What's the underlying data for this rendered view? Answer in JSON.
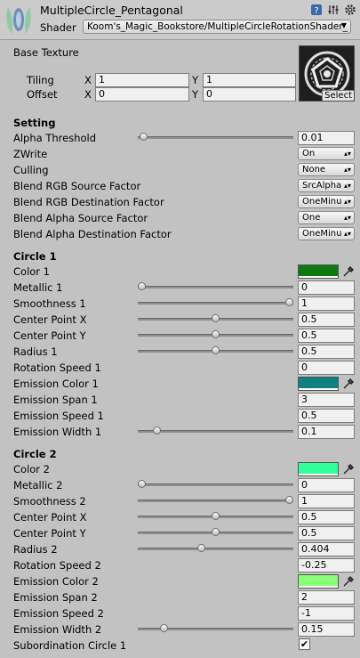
{
  "header": {
    "title": "MultipleCircle_Pentagonal",
    "shader_label": "Shader",
    "shader_value": "Koom's_Magic_Bookstore/MultipleCircleRotationShader_"
  },
  "base_texture": {
    "label": "Base Texture",
    "tiling_label": "Tiling",
    "offset_label": "Offset",
    "x_label": "X",
    "y_label": "Y",
    "tiling_x": "1",
    "tiling_y": "1",
    "offset_x": "0",
    "offset_y": "0",
    "select_label": "Select"
  },
  "setting": {
    "title": "Setting",
    "alpha_threshold": {
      "label": "Alpha Threshold",
      "value": "0.01",
      "level": 0.01
    },
    "zwrite": {
      "label": "ZWrite",
      "value": "On"
    },
    "culling": {
      "label": "Culling",
      "value": "None"
    },
    "blend_rgb_src": {
      "label": "Blend RGB Source Factor",
      "value": "SrcAlpha"
    },
    "blend_rgb_dst": {
      "label": "Blend RGB Destination Factor",
      "value": "OneMinu"
    },
    "blend_alpha_src": {
      "label": "Blend Alpha Source Factor",
      "value": "One"
    },
    "blend_alpha_dst": {
      "label": "Blend Alpha Destination Factor",
      "value": "OneMinu"
    }
  },
  "circle1": {
    "title": "Circle 1",
    "color": {
      "label": "Color 1",
      "color": "#0b7a12"
    },
    "metallic": {
      "label": "Metallic 1",
      "value": "0",
      "level": 0.0
    },
    "smoothness": {
      "label": "Smoothness 1",
      "value": "1",
      "level": 1.0
    },
    "center_x": {
      "label": "Center Point X",
      "value": "0.5",
      "level": 0.5
    },
    "center_y": {
      "label": "Center Point Y",
      "value": "0.5",
      "level": 0.5
    },
    "radius": {
      "label": "Radius 1",
      "value": "0.5",
      "level": 0.5
    },
    "rotation_speed": {
      "label": "Rotation Speed 1",
      "value": "0"
    },
    "emission_color": {
      "label": "Emission Color 1",
      "color": "#0f7f7f"
    },
    "emission_span": {
      "label": "Emission Span 1",
      "value": "3"
    },
    "emission_speed": {
      "label": "Emission Speed 1",
      "value": "0.5"
    },
    "emission_width": {
      "label": "Emission Width 1",
      "value": "0.1",
      "level": 0.1
    }
  },
  "circle2": {
    "title": "Circle 2",
    "color": {
      "label": "Color 2",
      "color": "#33ff99"
    },
    "metallic": {
      "label": "Metallic 2",
      "value": "0",
      "level": 0.0
    },
    "smoothness": {
      "label": "Smoothness 2",
      "value": "1",
      "level": 1.0
    },
    "center_x": {
      "label": "Center Point X",
      "value": "0.5",
      "level": 0.5
    },
    "center_y": {
      "label": "Center Point Y",
      "value": "0.5",
      "level": 0.5
    },
    "radius": {
      "label": "Radius 2",
      "value": "0.404",
      "level": 0.404
    },
    "rotation_speed": {
      "label": "Rotation Speed 2",
      "value": "-0.25"
    },
    "emission_color": {
      "label": "Emission Color 2",
      "color": "#88ff77"
    },
    "emission_span": {
      "label": "Emission Span 2",
      "value": "2"
    },
    "emission_speed": {
      "label": "Emission Speed 2",
      "value": "-1"
    },
    "emission_width": {
      "label": "Emission Width 2",
      "value": "0.15",
      "level": 0.15
    },
    "subordination": {
      "label": "Subordination Circle 1",
      "checked": true
    }
  }
}
